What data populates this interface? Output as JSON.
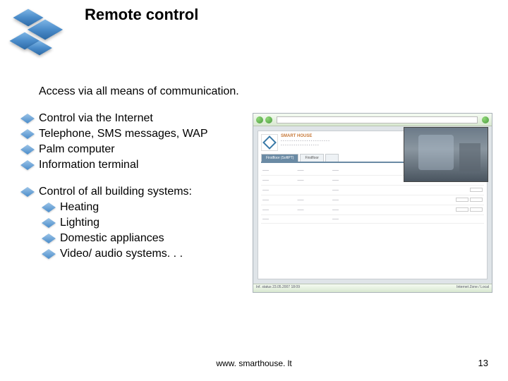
{
  "title": "Remote control",
  "intro": "Access via all means of communication.",
  "bullets_main": [
    "Control via the Internet",
    "Telephone, SMS messages, WAP",
    "Palm computer",
    "Information terminal"
  ],
  "section2_lead": "Control of all building systems:",
  "bullets_sub": [
    "Heating",
    "Lighting",
    "Domestic appliances",
    "Video/ audio systems. . ."
  ],
  "footer_url": "www. smarthouse. lt",
  "page_number": "13",
  "screenshot": {
    "brand": "SMART HOUSE",
    "tab_active": "Firstfloor (SoftPT)",
    "tab_other": "Firstfloor",
    "status_left": "Inf. status 23.05.2007   18:09",
    "status_right": "Internet Zone / Local"
  }
}
